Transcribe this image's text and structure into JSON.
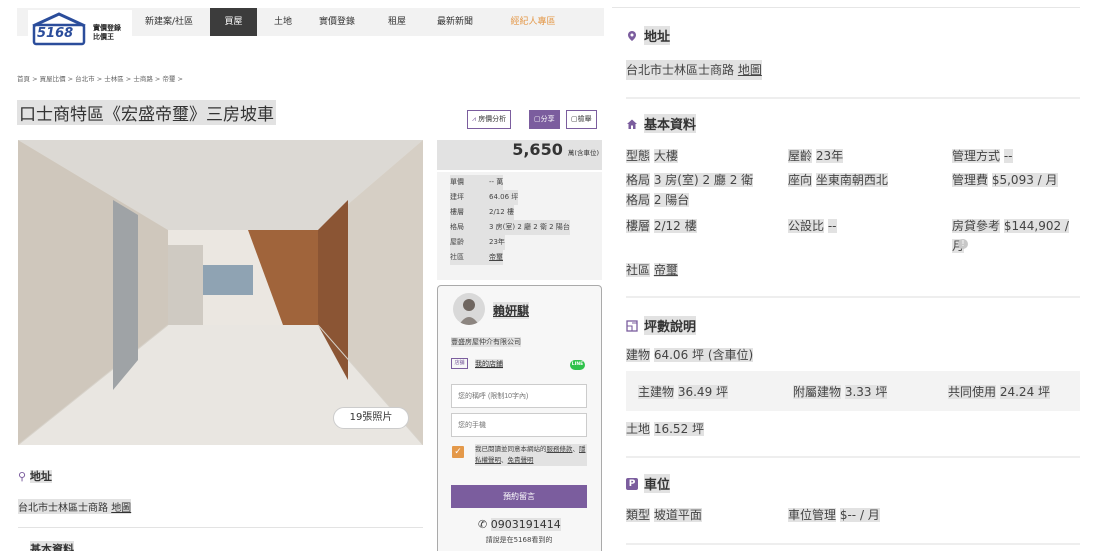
{
  "logo": {
    "text": "5168",
    "line1": "實價登錄",
    "line2": "比價王"
  },
  "nav": [
    {
      "label": "新建案/社區",
      "active": false
    },
    {
      "label": "買屋",
      "active": true
    },
    {
      "label": "土地",
      "active": false
    },
    {
      "label": "實價登錄",
      "active": false
    },
    {
      "label": "租屋",
      "active": false
    },
    {
      "label": "最新新聞",
      "active": false
    },
    {
      "label": "經紀人專區",
      "active": false
    }
  ],
  "breadcrumb": "首頁 > 買屋比價 > 台北市 > 士林區 > 士商路 > 帝璽 >",
  "title": "口士商特區《宏盛帝璽》三房坡車",
  "tools": {
    "analysis": "房價分析",
    "share": "分享",
    "report": "檢舉"
  },
  "photo": {
    "count_label": "19張照片"
  },
  "price": {
    "value": "5,650",
    "unit": "萬(含車位)"
  },
  "specs": [
    {
      "k": "單價",
      "v": "-- 萬"
    },
    {
      "k": "建坪",
      "v": "64.06 坪"
    },
    {
      "k": "樓層",
      "v": "2/12 樓"
    },
    {
      "k": "格局",
      "v": "3 房(室) 2 廳 2 衛 2 陽台"
    },
    {
      "k": "屋齡",
      "v": "23年"
    },
    {
      "k": "社區",
      "v": "帝璽"
    }
  ],
  "contact": {
    "name": "賴姸騏",
    "company": "豐盛房屋仲介有限公司",
    "shop_icon": "店舖",
    "shop_link": "我的店鋪",
    "line_badge": "LINE",
    "name_placeholder": "您的稱呼 (限制10字內)",
    "phone_placeholder": "您的手機",
    "consent_prefix": "我已閱讀並同意本網站的",
    "consent_terms": "服務條款",
    "consent_privacy": "隱私權聲明",
    "consent_disclaimer": "免責聲明",
    "submit": "預約留言",
    "phone": "0903191414",
    "phone_hint": "請說是在5168看到的"
  },
  "left_address": {
    "heading": "地址",
    "value": "台北市士林區士商路",
    "map_link": "地圖"
  },
  "left_basic_heading": "基本資料",
  "right": {
    "address": {
      "heading": "地址",
      "value": "台北市士林區士商路",
      "map_link": "地圖"
    },
    "basic": {
      "heading": "基本資料",
      "type_k": "型態",
      "type_v": "大樓",
      "age_k": "屋齡",
      "age_v": "23年",
      "mgmt_k": "管理方式",
      "mgmt_v": "--",
      "layout_k": "格局",
      "layout_v": "3 房(室) 2 廳 2 衛",
      "layout2_k": "格局",
      "layout2_v": "2 陽台",
      "facing_k": "座向",
      "facing_v": "坐東南朝西北",
      "fee_k": "管理費",
      "fee_v": "$5,093 / 月",
      "floor_k": "樓層",
      "floor_v": "2/12 樓",
      "share_k": "公設比",
      "share_v": "--",
      "loan_k": "房貸參考",
      "loan_v": "$144,902 /月",
      "community_k": "社區",
      "community_v": "帝璽"
    },
    "area": {
      "heading": "坪數說明",
      "building_k": "建物",
      "building_v": "64.06 坪 (含車位)",
      "main_k": "主建物",
      "main_v": "36.49 坪",
      "annex_k": "附屬建物",
      "annex_v": "3.33 坪",
      "common_k": "共同使用",
      "common_v": "24.24 坪",
      "land_k": "土地",
      "land_v": "16.52 坪"
    },
    "parking": {
      "heading": "車位",
      "type_k": "類型",
      "type_v": "坡道平面",
      "mgmt_k": "車位管理",
      "mgmt_v": "$-- / 月"
    }
  },
  "colors": {
    "brand_purple": "#7b5d9e",
    "accent_orange": "#e4994a",
    "nav_dark": "#3c3c3c",
    "line_green": "#2ec24a"
  }
}
